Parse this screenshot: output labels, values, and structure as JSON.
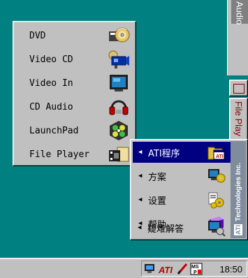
{
  "background_window": {
    "title": "Audio",
    "side_button_label": "File Play"
  },
  "main_menu": {
    "items": [
      {
        "label": "DVD",
        "icon": "dvd-disc-icon"
      },
      {
        "label": "Video CD",
        "icon": "video-cd-camera-icon"
      },
      {
        "label": "Video In",
        "icon": "tv-monitor-icon"
      },
      {
        "label": "CD Audio",
        "icon": "headphones-icon"
      },
      {
        "label": "LaunchPad",
        "icon": "launchpad-icon"
      },
      {
        "label": "File Player",
        "icon": "file-player-icon"
      }
    ]
  },
  "ati_submenu": {
    "items": [
      {
        "label": "ATI程序",
        "icon": "ati-programs-folder-icon",
        "selected": true
      },
      {
        "label": "方案",
        "icon": "schemes-monitor-gear-icon",
        "selected": false
      },
      {
        "label": "设置",
        "icon": "settings-gear-icon",
        "selected": false
      },
      {
        "label": "帮助",
        "icon": "help-book-icon",
        "selected": false
      },
      {
        "label": "疑难解答",
        "icon": "troubleshoot-icon",
        "selected": false
      }
    ],
    "brand_text": "Technologies Inc.",
    "brand_logo": "ATI"
  },
  "taskbar": {
    "clock": "18:50",
    "tray_icons": [
      "display-tray-icon",
      "ati-tray-icon",
      "pencil-tray-icon",
      "mspaint-tray-icon"
    ]
  },
  "colors": {
    "desktop": "#008080",
    "menu_face": "#c0c0c0",
    "selection": "#000080"
  }
}
